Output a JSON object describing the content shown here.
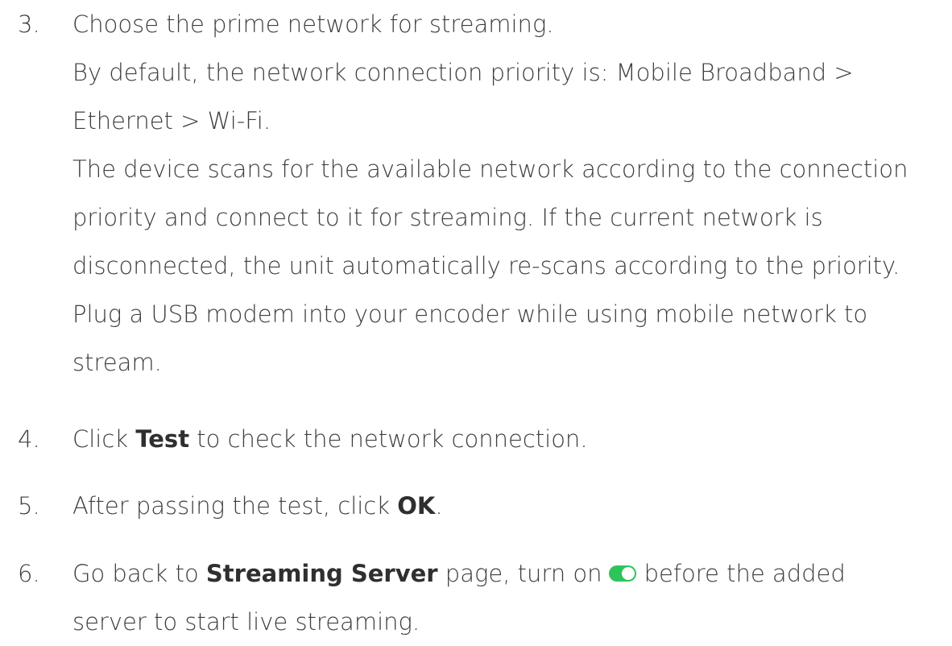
{
  "steps": [
    {
      "number": "3.",
      "lines": [
        "Choose the prime network for streaming.",
        "By default, the network connection priority is: Mobile Broadband >",
        "Ethernet > Wi-Fi.",
        "The device scans for the available network according to the connection",
        "priority and connect to it for streaming. If the current network is",
        "disconnected, the unit automatically re-scans according to the priority.",
        "Plug a USB modem into your encoder while using mobile network to",
        "stream."
      ]
    },
    {
      "number": "4.",
      "before": "Click ",
      "bold": "Test",
      "after": " to check the network connection."
    },
    {
      "number": "5.",
      "before": "After passing the test, click ",
      "bold": "OK",
      "after": "."
    },
    {
      "number": "6.",
      "before": "Go back to ",
      "bold": "Streaming Server",
      "middle": " page, turn on",
      "after": "before the added",
      "line2": "server to start live streaming."
    }
  ],
  "toggle": {
    "state": "on",
    "color": "#2ec45a",
    "icon": "toggle-switch-on-icon"
  }
}
